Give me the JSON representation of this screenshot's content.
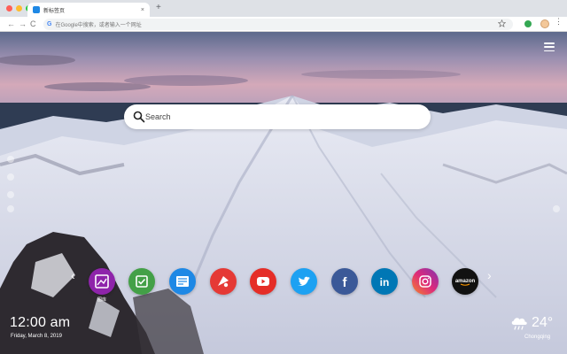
{
  "browser": {
    "tab_title": "新标签页",
    "tab_close": "×",
    "new_tab": "+",
    "back": "←",
    "forward": "→",
    "reload": "C",
    "omnibox_icon": "G",
    "omnibox_placeholder": "在Google中搜索，或者输入一个网址",
    "bookmark_icon": "star-icon",
    "menu_icon": "⋮",
    "colors": {
      "close": "#ff5f57",
      "minimize": "#febc2e",
      "maximize": "#28c840"
    }
  },
  "search": {
    "placeholder": "Search",
    "icon": "search-icon"
  },
  "quick_links": [
    {
      "name": "图库",
      "icon": "gallery-icon",
      "color": "#8e24aa"
    },
    {
      "name": "",
      "icon": "check-icon",
      "color": "#43a047"
    },
    {
      "name": "",
      "icon": "news-icon",
      "color": "#1e88e5"
    },
    {
      "name": "",
      "icon": "game-icon",
      "color": "#e53935"
    },
    {
      "name": "",
      "icon": "youtube-icon",
      "color": "#e52d27"
    },
    {
      "name": "",
      "icon": "twitter-icon",
      "color": "#1da1f2"
    },
    {
      "name": "",
      "icon": "facebook-icon",
      "color": "#3b5998"
    },
    {
      "name": "",
      "icon": "linkedin-icon",
      "color": "#0077b5"
    },
    {
      "name": "",
      "icon": "instagram-icon",
      "color": "#e1306c"
    },
    {
      "name": "",
      "icon": "amazon-icon",
      "color": "#111111"
    }
  ],
  "amazon_text": "amazon",
  "linkedin_text": "in",
  "facebook_text": "f",
  "nav": {
    "prev": "‹",
    "next": "›"
  },
  "clock": {
    "time": "12:00 am",
    "date": "Friday, March 8, 2019"
  },
  "weather": {
    "temp": "24°",
    "city": "Chongqing",
    "icon": "cloud-rain-icon"
  }
}
